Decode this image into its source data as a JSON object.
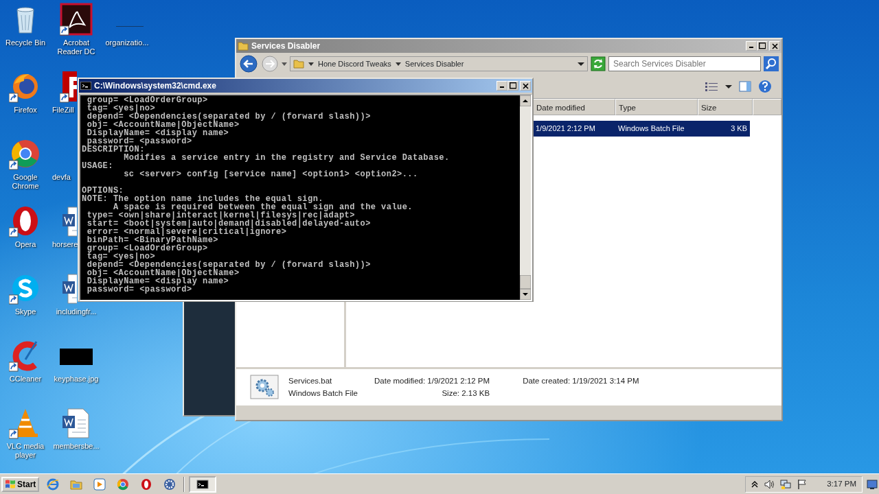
{
  "desktop_columns": [
    [
      {
        "label": "Recycle Bin",
        "kind": "recycle",
        "shortcut": false
      },
      {
        "label": "Firefox",
        "kind": "firefox",
        "shortcut": true
      },
      {
        "label": "Google Chrome",
        "kind": "chrome",
        "shortcut": true
      },
      {
        "label": "Opera",
        "kind": "opera",
        "shortcut": true
      },
      {
        "label": "Skype",
        "kind": "skype",
        "shortcut": true
      },
      {
        "label": "CCleaner",
        "kind": "ccleaner",
        "shortcut": true
      },
      {
        "label": "VLC media player",
        "kind": "vlc",
        "shortcut": true
      }
    ],
    [
      {
        "label": "Acrobat Reader DC",
        "kind": "acrobat",
        "shortcut": true
      },
      {
        "label": "FileZill",
        "kind": "filezilla",
        "shortcut": true
      },
      {
        "label": "devfa",
        "kind": "none"
      },
      {
        "label": "horsere",
        "kind": "word",
        "shortcut": false
      },
      {
        "label": "includingfr...",
        "kind": "word",
        "shortcut": false
      },
      {
        "label": "keyphase.jpg",
        "kind": "image",
        "shortcut": false
      },
      {
        "label": "membersbe...",
        "kind": "word",
        "shortcut": false
      }
    ],
    [
      {
        "label": "organizatio...",
        "kind": "blank",
        "shortcut": false
      }
    ]
  ],
  "explorer": {
    "title": "Services Disabler",
    "breadcrumb": [
      "Hone Discord Tweaks",
      "Services Disabler"
    ],
    "search": {
      "placeholder": "Search Services Disabler"
    },
    "columns": [
      "Date modified",
      "Type",
      "Size"
    ],
    "rows": [
      {
        "cells": [
          "1/9/2021 2:12 PM",
          "Windows Batch File",
          "3 KB"
        ],
        "selected": true
      }
    ],
    "details": {
      "name": "Services.bat",
      "type": "Windows Batch File",
      "fields": [
        {
          "label": "Date modified:",
          "value": "1/9/2021 2:12 PM"
        },
        {
          "label": "Size:",
          "value": "2.13 KB"
        },
        {
          "label": "Date created:",
          "value": "1/19/2021 3:14 PM"
        }
      ]
    }
  },
  "console": {
    "title": "C:\\Windows\\system32\\cmd.exe",
    "blocks": [
      [
        " group= <LoadOrderGroup>",
        " tag= <yes|no>",
        " depend= <Dependencies(separated by / (forward slash))>",
        " obj= <AccountName|ObjectName>",
        " DisplayName= <display name>",
        " password= <password>",
        "DESCRIPTION:",
        "        Modifies a service entry in the registry and Service Database.",
        "USAGE:",
        "        sc <server> config [service name] <option1> <option2>..."
      ],
      [
        "OPTIONS:",
        "NOTE: The option name includes the equal sign.",
        "      A space is required between the equal sign and the value.",
        " type= <own|share|interact|kernel|filesys|rec|adapt>",
        " start= <boot|system|auto|demand|disabled|delayed-auto>",
        " error= <normal|severe|critical|ignore>",
        " binPath= <BinaryPathName>",
        " group= <LoadOrderGroup>",
        " tag= <yes|no>",
        " depend= <Dependencies(separated by / (forward slash))>",
        " obj= <AccountName|ObjectName>",
        " DisplayName= <display name>",
        " password= <password>"
      ]
    ]
  },
  "taskbar": {
    "start": "Start",
    "apps": [
      {
        "kind": "ie",
        "active": false
      },
      {
        "kind": "folder",
        "active": false
      },
      {
        "kind": "media",
        "active": false
      },
      {
        "kind": "chrome",
        "active": false
      },
      {
        "kind": "opera",
        "active": false
      },
      {
        "kind": "gear",
        "active": false
      },
      {
        "kind": "cmd",
        "active": true
      }
    ],
    "clock": "3:17 PM"
  }
}
